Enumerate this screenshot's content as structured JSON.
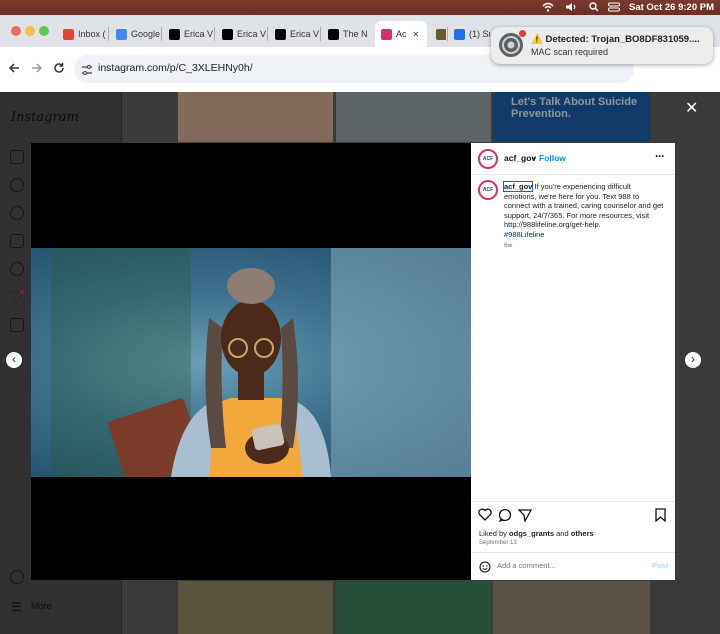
{
  "menubar": {
    "datetime": "Sat Oct 26  9:20 PM"
  },
  "tabs": [
    {
      "label": "Inbox (",
      "favicon_color": "#ea4335",
      "favicon_name": "gmail-icon"
    },
    {
      "label": "Google",
      "favicon_color": "#4285f4",
      "favicon_name": "google-docs-icon"
    },
    {
      "label": "Erica V",
      "favicon_color": "#000000",
      "favicon_name": "x-icon"
    },
    {
      "label": "Erica V",
      "favicon_color": "#000000",
      "favicon_name": "x-icon"
    },
    {
      "label": "Erica V",
      "favicon_color": "#000000",
      "favicon_name": "x-icon"
    },
    {
      "label": "The N",
      "favicon_color": "#000000",
      "favicon_name": "nyt-icon"
    },
    {
      "label": "Ac",
      "favicon_color": "#d6306f",
      "favicon_name": "instagram-icon",
      "active": true
    },
    {
      "label": "",
      "favicon_color": "#6b5a2e",
      "favicon_name": "site-icon"
    },
    {
      "label": "(1) Sui",
      "favicon_color": "#1a73e8",
      "favicon_name": "site-icon"
    }
  ],
  "address": {
    "url": "instagram.com/p/C_3XLEHNy0h/"
  },
  "notification": {
    "title": "⚠️ Detected: Trojan_BO8DF831059....",
    "subtitle": "MAC scan required",
    "badge_color": "#e53935"
  },
  "instagram": {
    "logo": "Instagram",
    "more_label": "More",
    "thumbnail_caption": "Let's Talk About Suicide Prevention.",
    "post": {
      "username": "acf_gov",
      "follow_label": "Follow",
      "caption_user": "acf_gov",
      "caption": "If you're experiencing difficult emotions, we're here for you. Text 988 to connect with a trained, caring counselor and get support, 24/7/365. For more resources, visit http://988lifeline.org/get-help.",
      "hashtag": "#988Lifeline",
      "age": "6w",
      "liked_by_prefix": "Liked by ",
      "liked_by_user": "odgs_grants",
      "liked_by_suffix": " and ",
      "liked_by_others": "others",
      "date": "September 13",
      "comment_placeholder": "Add a comment...",
      "post_label": "Post",
      "avatar_text": "ACF"
    }
  }
}
